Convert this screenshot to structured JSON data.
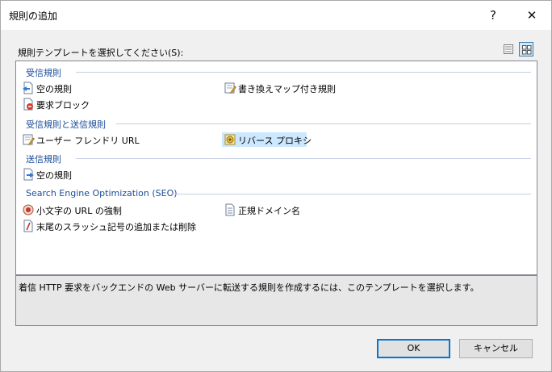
{
  "window": {
    "title": "規則の追加",
    "help_glyph": "?",
    "close_glyph": "✕"
  },
  "prompt": "規則テンプレートを選択してください(S):",
  "view_buttons": [
    {
      "icon": "details-view-icon",
      "selected": false
    },
    {
      "icon": "tile-view-icon",
      "selected": true
    }
  ],
  "groups": [
    {
      "title": "受信規則",
      "items": [
        {
          "label": "空の規則",
          "icon": "blank-rule-icon"
        },
        {
          "label": "書き換えマップ付き規則",
          "icon": "rewrite-map-icon"
        },
        {
          "label": "要求ブロック",
          "icon": "request-blocking-icon"
        }
      ]
    },
    {
      "title": "受信規則と送信規則",
      "items": [
        {
          "label": "ユーザー フレンドリ URL",
          "icon": "user-friendly-url-icon"
        },
        {
          "label": "リバース プロキシ",
          "icon": "reverse-proxy-icon",
          "selected": true
        }
      ]
    },
    {
      "title": "送信規則",
      "items": [
        {
          "label": "空の規則",
          "icon": "blank-outbound-rule-icon"
        }
      ]
    },
    {
      "title": "Search Engine Optimization (SEO)",
      "items": [
        {
          "label": "小文字の URL の強制",
          "icon": "lowercase-url-icon"
        },
        {
          "label": "正規ドメイン名",
          "icon": "canonical-domain-icon"
        },
        {
          "label": "末尾のスラッシュ記号の追加または削除",
          "icon": "trailing-slash-icon"
        }
      ]
    }
  ],
  "description": "着信 HTTP 要求をバックエンドの Web サーバーに転送する規則を作成するには、このテンプレートを選択します。",
  "buttons": {
    "ok": "OK",
    "cancel": "キャンセル"
  },
  "colors": {
    "accent": "#0078d7",
    "group_title": "#1c4d98",
    "selection": "#cce8ff"
  }
}
